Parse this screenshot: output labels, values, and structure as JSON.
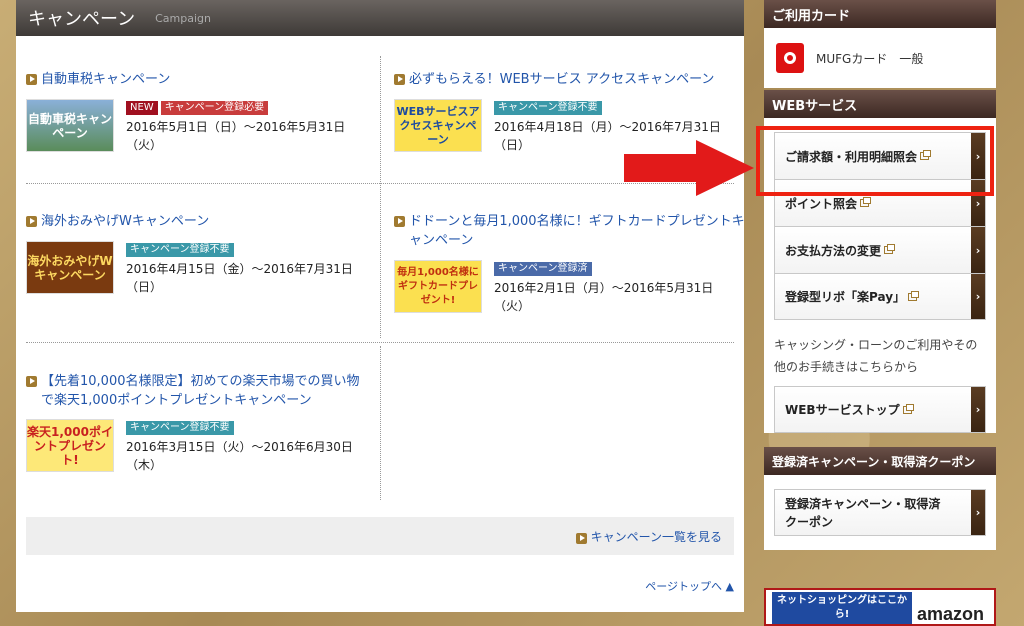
{
  "campaign": {
    "title": "キャンペーン",
    "subtitle": "Campaign",
    "items": [
      {
        "title": "自動車税キャンペーン",
        "thumb_text": "自動車税キャンペーン",
        "badges": [
          "NEW",
          "キャンペーン登録必要"
        ],
        "period": "2016年5月1日（日）〜2016年5月31日（火）"
      },
      {
        "title": "必ずもらえる！WEBサービス アクセスキャンペーン",
        "thumb_text": "WEBサービスアクセスキャンペーン",
        "badges": [
          "キャンペーン登録不要"
        ],
        "period": "2016年4月18日（月）〜2016年7月31日（日）"
      },
      {
        "title": "海外おみやげWキャンペーン",
        "thumb_text": "海外おみやげWキャンペーン",
        "badges": [
          "キャンペーン登録不要"
        ],
        "period": "2016年4月15日（金）〜2016年7月31日（日）"
      },
      {
        "title": "ドドーンと毎月1,000名様に！ギフトカードプレゼントキャンペーン",
        "thumb_text": "毎月1,000名様にギフトカードプレゼント!",
        "badges": [
          "キャンペーン登録済"
        ],
        "period": "2016年2月1日（月）〜2016年5月31日（火）"
      },
      {
        "title": "【先着10,000名様限定】初めての楽天市場での買い物で楽天1,000ポイントプレゼントキャンペーン",
        "thumb_text": "楽天1,000ポイントプレゼント!",
        "badges": [
          "キャンペーン登録不要"
        ],
        "period": "2016年3月15日（火）〜2016年6月30日（木）"
      }
    ],
    "list_link": "キャンペーン一覧を見る",
    "page_top": "ページトップへ ▲"
  },
  "sidebar": {
    "card_header": "ご利用カード",
    "card_name": "MUFGカード　一般",
    "web_header": "WEBサービス",
    "web_buttons": [
      "ご請求額・利用明細照会",
      "ポイント照会",
      "お支払方法の変更",
      "登録型リボ「楽Pay」"
    ],
    "note": "キャッシング・ローンのご利用やその他のお手続きはこちらから",
    "web_top": "WEBサービストップ",
    "reg_header": "登録済キャンペーン・取得済クーポン",
    "reg_button": "登録済キャンペーン・取得済クーポン",
    "ad_text": "ネットショッピングはここから!",
    "ad_brand": "amazon"
  },
  "colors": {
    "highlight": "#ee2211",
    "link": "#2255aa"
  }
}
